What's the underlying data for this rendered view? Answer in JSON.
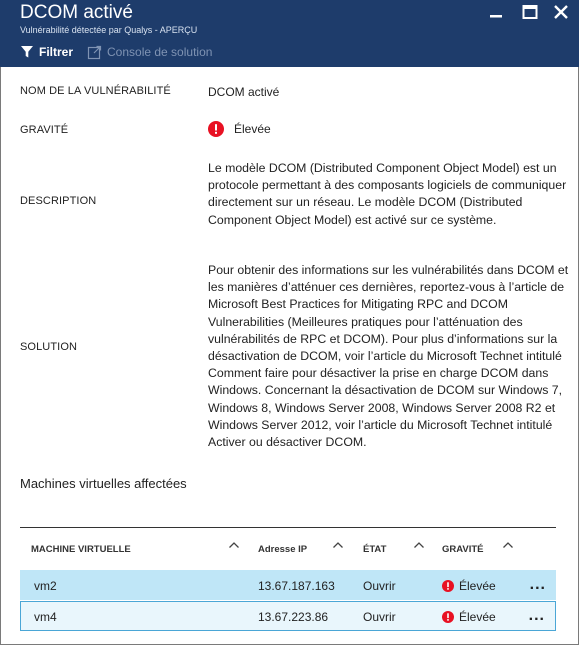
{
  "header": {
    "title": "DCOM activé",
    "subtitle": "Vulnérabilité détectée par Qualys - APERÇU"
  },
  "toolbar": {
    "filter_label": "Filtrer",
    "console_label": "Console de solution"
  },
  "details": {
    "name_label": "NOM DE LA VULNÉRABILITÉ",
    "name_value": "DCOM activé",
    "severity_label": "GRAVITÉ",
    "severity_value": "Élevée",
    "description_label": "DESCRIPTION",
    "description_value": "Le modèle DCOM (Distributed Component Object Model) est un protocole permettant à des composants logiciels de communiquer directement sur un réseau. Le modèle DCOM (Distributed Component Object Model) est activé sur ce système.",
    "solution_label": "SOLUTION",
    "solution_value": "Pour obtenir des informations sur les vulnérabilités dans DCOM et les manières d’atténuer ces dernières, reportez-vous à l’article de Microsoft Best Practices for Mitigating RPC and DCOM Vulnerabilities (Meilleures pratiques pour l’atténuation des vulnérabilités de RPC et DCOM). Pour plus d’informations sur la désactivation de DCOM, voir l’article du Microsoft Technet intitulé Comment faire pour désactiver la prise en charge DCOM dans Windows. Concernant la désactivation de DCOM sur Windows 7, Windows 8, Windows Server 2008, Windows Server 2008 R2 et Windows Server 2012, voir l’article du Microsoft Technet intitulé Activer ou désactiver DCOM."
  },
  "vms": {
    "section_title": "Machines virtuelles affectées",
    "columns": [
      "MACHINE VIRTUELLE",
      "Adresse IP",
      "ÉTAT",
      "GRAVITÉ"
    ],
    "rows": [
      {
        "name": "vm2",
        "ip": "13.67.187.163",
        "state": "Ouvrir",
        "severity": "Élevée",
        "more": "..."
      },
      {
        "name": "vm4",
        "ip": "13.67.223.86",
        "state": "Ouvrir",
        "severity": "Élevée",
        "more": "..."
      }
    ]
  },
  "colors": {
    "header_bg": "#1e3c6b",
    "severity_red": "#e81123",
    "row_selected": "#bfe6f7",
    "row_focus_border": "#4aa6d6"
  },
  "icons": {
    "filter": "filter-icon",
    "console": "external-link-icon",
    "minimize": "minimize-icon",
    "maximize": "maximize-icon",
    "close": "close-icon",
    "severity": "error-icon",
    "sort": "chevron-up-icon"
  }
}
